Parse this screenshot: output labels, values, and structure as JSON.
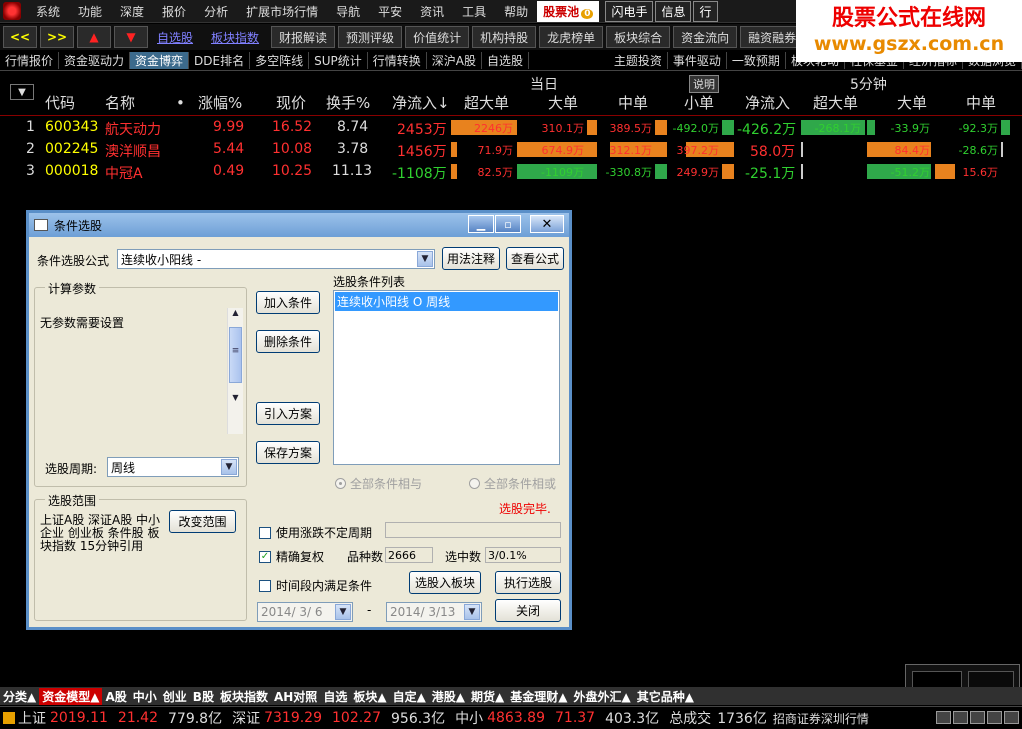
{
  "menu": {
    "items": [
      "系统",
      "功能",
      "深度",
      "报价",
      "分析",
      "扩展市场行情",
      "导航",
      "平安",
      "资讯",
      "工具",
      "帮助"
    ],
    "highlight": "股票池",
    "highlight_badge": "0",
    "right_buttons": [
      "闪电手",
      "信息",
      "行"
    ]
  },
  "watermark": {
    "line1": "股票公式在线网",
    "line2": "www.gszx.com.cn"
  },
  "toolbar": {
    "arrow_left": "<<",
    "arrow_right": ">>",
    "up": "▲",
    "down": "▼",
    "links": [
      "自选股",
      "板块指数"
    ],
    "buttons": [
      "财报解读",
      "预测评级",
      "价值统计",
      "机构持股",
      "龙虎榜单",
      "板块综合",
      "资金流向",
      "融资融券",
      "持"
    ]
  },
  "subtabs": {
    "left": [
      "行情报价",
      "资金驱动力",
      "资金博弈",
      "DDE排名",
      "多空阵线",
      "SUP统计",
      "行情转换",
      "深沪A股",
      "自选股"
    ],
    "right": [
      "主题投资",
      "事件驱动",
      "一致预期",
      "板块轮动",
      "社保基金",
      "经济指标",
      "数据浏览"
    ],
    "active": "资金博弈"
  },
  "table": {
    "group_today": "当日",
    "group_5min": "5分钟",
    "explain": "说明",
    "columns": [
      "代码",
      "名称",
      "•",
      "涨幅%",
      "现价",
      "换手%",
      "净流入↓",
      "超大单",
      "大单",
      "中单",
      "小单",
      "净流入",
      "超大单",
      "大单",
      "中单"
    ],
    "rows": [
      {
        "idx": "1",
        "code": "600343",
        "name": "航天动力",
        "chg": "9.99",
        "price": "16.52",
        "turn": "8.74",
        "net": "2453万",
        "b1": "2246万",
        "b2": "310.1万",
        "b3": "389.5万",
        "b4": "-492.0万",
        "net5": "-426.2万",
        "f1": "-268.1万",
        "f2": "-33.9万",
        "f3": "-92.3万"
      },
      {
        "idx": "2",
        "code": "002245",
        "name": "澳洋顺昌",
        "chg": "5.44",
        "price": "10.08",
        "turn": "3.78",
        "net": "1456万",
        "b1": "71.9万",
        "b2": "674.9万",
        "b3": "312.1万",
        "b4": "397.2万",
        "net5": "58.0万",
        "f1": "",
        "f2": "84.4万",
        "f3": "-28.6万"
      },
      {
        "idx": "3",
        "code": "000018",
        "name": "中冠A",
        "chg": "0.49",
        "price": "10.25",
        "turn": "11.13",
        "net": "-1108万",
        "b1": "82.5万",
        "b2": "-1109万",
        "b3": "-330.8万",
        "b4": "249.9万",
        "net5": "-25.1万",
        "f1": "",
        "f2": "-51.2万",
        "f3": "15.6万"
      }
    ]
  },
  "dialog": {
    "title": "条件选股",
    "formula_label": "条件选股公式",
    "formula_value": "连续收小阳线 -",
    "usage_btn": "用法注释",
    "view_btn": "查看公式",
    "params_group": "计算参数",
    "params_text": "无参数需要设置",
    "period_label": "选股周期:",
    "period_value": "周线",
    "range_group": "选股范围",
    "range_text": "上证A股 深证A股 中小企业 创业板 条件股 板块指数 15分钟引用",
    "change_range_btn": "改变范围",
    "add_btn": "加入条件",
    "del_btn": "删除条件",
    "import_btn": "引入方案",
    "save_btn": "保存方案",
    "list_label": "选股条件列表",
    "list_items": [
      "连续收小阳线  O  周线"
    ],
    "radio_and": "全部条件相与",
    "radio_or": "全部条件相或",
    "done_text": "选股完毕.",
    "chk_uncertain": "使用涨跌不定周期",
    "chk_adjust": "精确复权",
    "count_label": "品种数",
    "count_value": "2666",
    "selected_label": "选中数",
    "selected_value": "3/0.1%",
    "chk_time": "时间段内满足条件",
    "to_block_btn": "选股入板块",
    "exec_btn": "执行选股",
    "close_btn": "关闭",
    "date_from": "2014/ 3/ 6",
    "date_sep": "-",
    "date_to": "2014/ 3/13"
  },
  "bottomtabs": [
    "分类▲",
    "资金模型▲",
    "A股",
    "中小",
    "创业",
    "B股",
    "板块指数",
    "AH对照",
    "自选",
    "板块▲",
    "自定▲",
    "港股▲",
    "期货▲",
    "基金理财▲",
    "外盘外汇▲",
    "其它品种▲"
  ],
  "status": {
    "sh_label": "上证",
    "sh_val": "2019.11",
    "sh_chg": "21.42",
    "sh_amt": "779.8亿",
    "sz_label": "深证",
    "sz_val": "7319.29",
    "sz_chg": "102.27",
    "sz_amt": "956.3亿",
    "zx_label": "中小",
    "zx_val": "4863.89",
    "zx_chg": "71.37",
    "zx_amt": "403.3亿",
    "total_label": "总成交",
    "total_val": "1736亿",
    "broker": "招商证券深圳行情"
  },
  "colors": {
    "red": "#ff3030",
    "green": "#30d030",
    "yellow": "#ffff00",
    "orange_bar": "#e8821e",
    "green_bar": "#2fa84a"
  }
}
